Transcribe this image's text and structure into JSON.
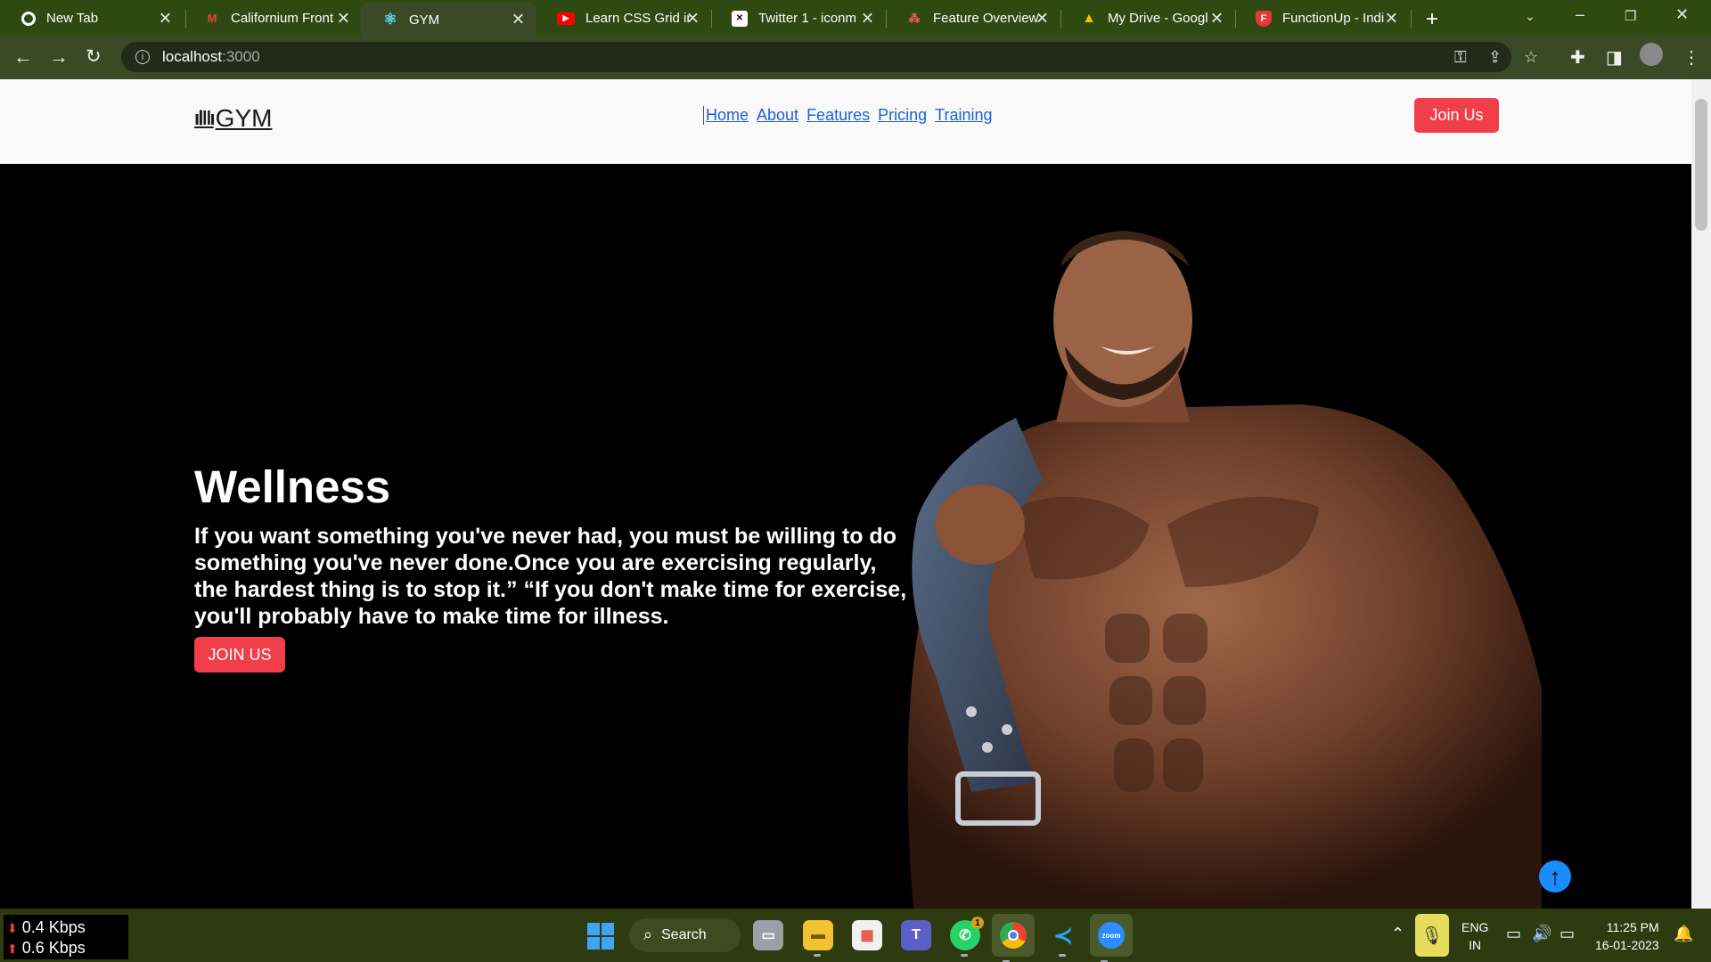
{
  "browser": {
    "tabs": [
      {
        "label": "New Tab",
        "icon": "chrome-icon",
        "color": "#ffffff"
      },
      {
        "label": "Californium Front",
        "icon": "gmail-icon",
        "color": "#ea4335"
      },
      {
        "label": "GYM",
        "icon": "react-icon",
        "color": "#61dafb",
        "active": true
      },
      {
        "label": "Learn CSS Grid in",
        "icon": "youtube-icon",
        "color": "#ff0000"
      },
      {
        "label": "Twitter 1 - iconm",
        "icon": "iconmonstr-icon",
        "color": "#ffffff"
      },
      {
        "label": "Feature Overview",
        "icon": "feature-icon",
        "color": "#ff5b5b"
      },
      {
        "label": "My Drive - Googl",
        "icon": "google-drive-icon",
        "color": "#fbbc04"
      },
      {
        "label": "FunctionUp - Indi",
        "icon": "functionup-icon",
        "color": "#e53935"
      }
    ],
    "url_host": "localhost",
    "url_port": ":3000"
  },
  "site": {
    "logo_text": "GYM",
    "nav": [
      "Home",
      "About",
      "Features",
      "Pricing",
      "Training"
    ],
    "header_cta": "Join Us",
    "hero": {
      "title": "Wellness",
      "text": "If you want something you've never had, you must be willing to do something you've never done.Once you are exercising regularly, the hardest thing is to stop it.” “If you don't make time for exercise, you'll probably have to make time for illness.",
      "cta": "JOIN US"
    },
    "accent_color": "#f03e4a",
    "link_color": "#1a62d6"
  },
  "taskbar": {
    "net_down": "0.4 Kbps",
    "net_up": "0.6 Kbps",
    "search_label": "Search",
    "whatsapp_badge": "1",
    "zoom_label": "zoom",
    "lang_line1": "ENG",
    "lang_line2": "IN",
    "time": "11:25 PM",
    "date": "16-01-2023"
  }
}
